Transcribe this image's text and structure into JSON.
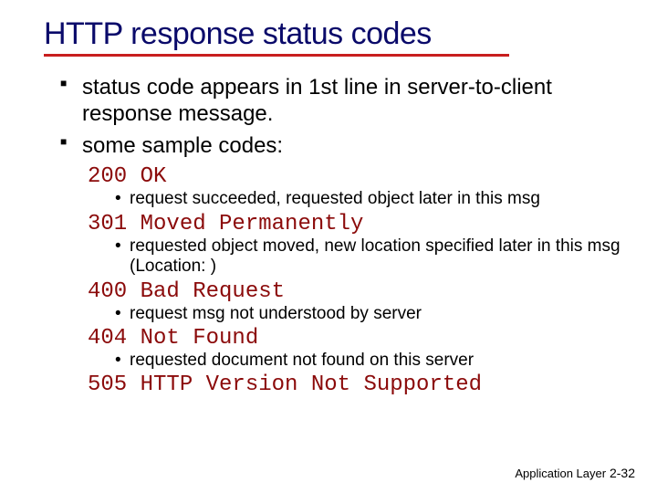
{
  "title": "HTTP response status codes",
  "bullets": [
    "status code appears in 1st line in server-to-client response message.",
    "some sample codes:"
  ],
  "codes": [
    {
      "code": "200 OK",
      "desc": "request succeeded, requested object later in this msg"
    },
    {
      "code": "301 Moved Permanently",
      "desc": "requested object moved, new location specified later in this msg (Location: )"
    },
    {
      "code": "400 Bad Request",
      "desc": "request msg not understood by server"
    },
    {
      "code": "404 Not Found",
      "desc": "requested document not found on this server"
    },
    {
      "code": "505 HTTP Version Not Supported",
      "desc": ""
    }
  ],
  "footer": {
    "section": "Application Layer",
    "page": "2-32"
  }
}
